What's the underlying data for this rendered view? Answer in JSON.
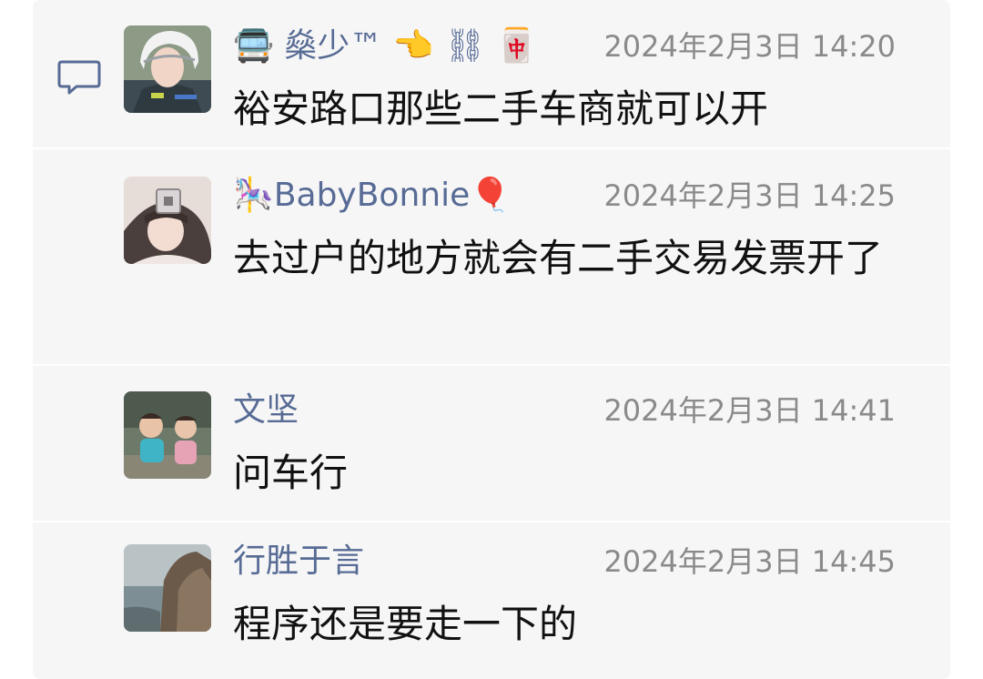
{
  "comments": [
    {
      "name": "🚍 燊少™ 👈 ⛓ 🀄",
      "time": "2024年2月3日 14:20",
      "text": "裕安路口那些二手车商就可以开"
    },
    {
      "name": "🎠BabyBonnie🎈",
      "time": "2024年2月3日 14:25",
      "text": "去过户的地方就会有二手交易发票开了"
    },
    {
      "name": "文坚",
      "time": "2024年2月3日 14:41",
      "text": "问车行"
    },
    {
      "name": "行胜于言",
      "time": "2024年2月3日 14:45",
      "text": "程序还是要走一下的"
    }
  ],
  "colors": {
    "name": "#576b95",
    "time": "#8a8a8a",
    "text": "#111111",
    "panel": "#f6f6f6"
  },
  "icons": {
    "comment": "comment-bubble-icon"
  }
}
